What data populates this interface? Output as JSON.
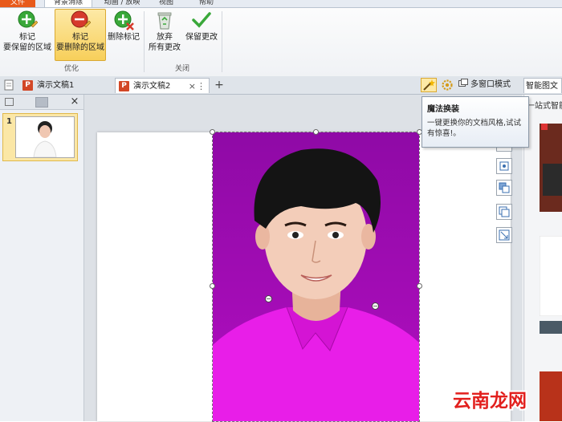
{
  "ribbon": {
    "tab_file": "文件",
    "tab_active": "背景消除",
    "tab_design": "动画 / 放映",
    "tab_view": "视图",
    "tab_other": "帮助",
    "buttons": {
      "mark_keep": "标记\n要保留的区域",
      "mark_remove": "标记\n要删除的区域",
      "delete_mark": "删除标记",
      "discard": "放弃\n所有更改",
      "keep_changes": "保留更改"
    },
    "groups": {
      "optimize": "优化",
      "close": "关闭"
    }
  },
  "docbar": {
    "tab1": "演示文稿1",
    "tab2": "演示文稿2",
    "close_glyph": "×",
    "more_glyph": "⋮",
    "new_tab_glyph": "+",
    "ppt_glyph": "P",
    "multi_window": "多窗口模式",
    "smart_tab": "智能图文"
  },
  "left_panel": {
    "close_glyph": "×",
    "slide_number": "1"
  },
  "right_panel": {
    "text": "一站式智能"
  },
  "tooltip": {
    "title": "魔法换装",
    "body": "一键更换你的文档风格,试试有惊喜!。"
  },
  "watermark": {
    "text": "云南龙网"
  },
  "colors": {
    "photo_bg": "#8a0a9e",
    "shirt": "#e81ee8",
    "file_tab": "#e85a1b",
    "selected_button": "#f7cf5a"
  },
  "icons": {
    "mark_keep": "plus-green-pencil-icon",
    "mark_remove": "minus-red-pencil-icon",
    "delete_mark": "plus-x-icon",
    "discard": "recycle-bin-icon",
    "keep_changes": "checkmark-icon",
    "magic": "magic-wand-icon",
    "gear": "gear-icon",
    "multi_window": "windows-icon"
  }
}
